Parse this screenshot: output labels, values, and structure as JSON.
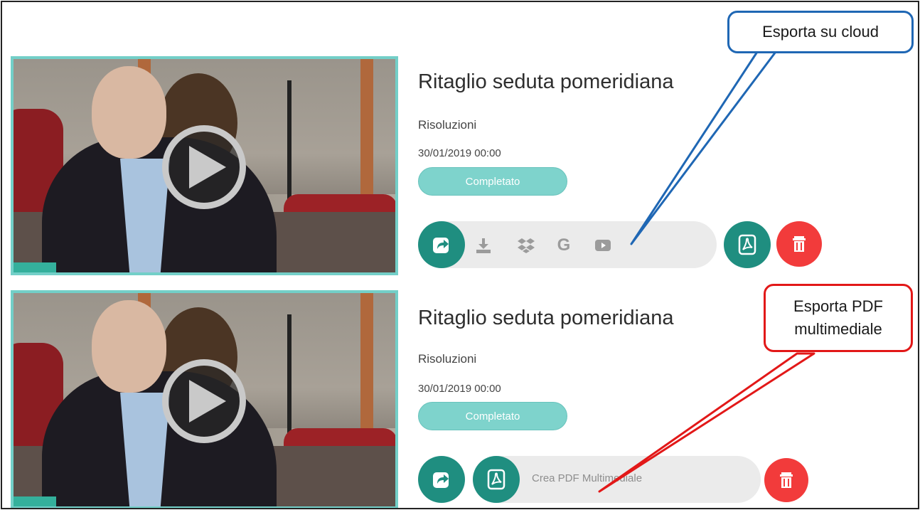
{
  "items": [
    {
      "title": "Ritaglio seduta pomeridiana",
      "category": "Risoluzioni",
      "date": "30/01/2019 00:00",
      "status": "Completato",
      "actions": [
        "share-icon",
        "download-icon",
        "dropbox-icon",
        "google-icon",
        "youtube-icon",
        "pdf-icon",
        "trash-icon"
      ],
      "google_glyph": "G"
    },
    {
      "title": "Ritaglio seduta pomeridiana",
      "category": "Risoluzioni",
      "date": "30/01/2019 00:00",
      "status": "Completato",
      "pdf_label": "Crea PDF Multimediale",
      "actions": [
        "share-icon",
        "pdf-icon",
        "trash-icon"
      ]
    }
  ],
  "callouts": {
    "cloud": "Esporta su cloud",
    "pdf_line1": "Esporta PDF",
    "pdf_line2": "multimediale"
  },
  "colors": {
    "teal": "#1f8e80",
    "badge": "#7ed3cc",
    "thumb_border": "#73cfc8",
    "danger": "#f23b3b",
    "callout_blue": "#1f67b4",
    "callout_red": "#e21818"
  }
}
